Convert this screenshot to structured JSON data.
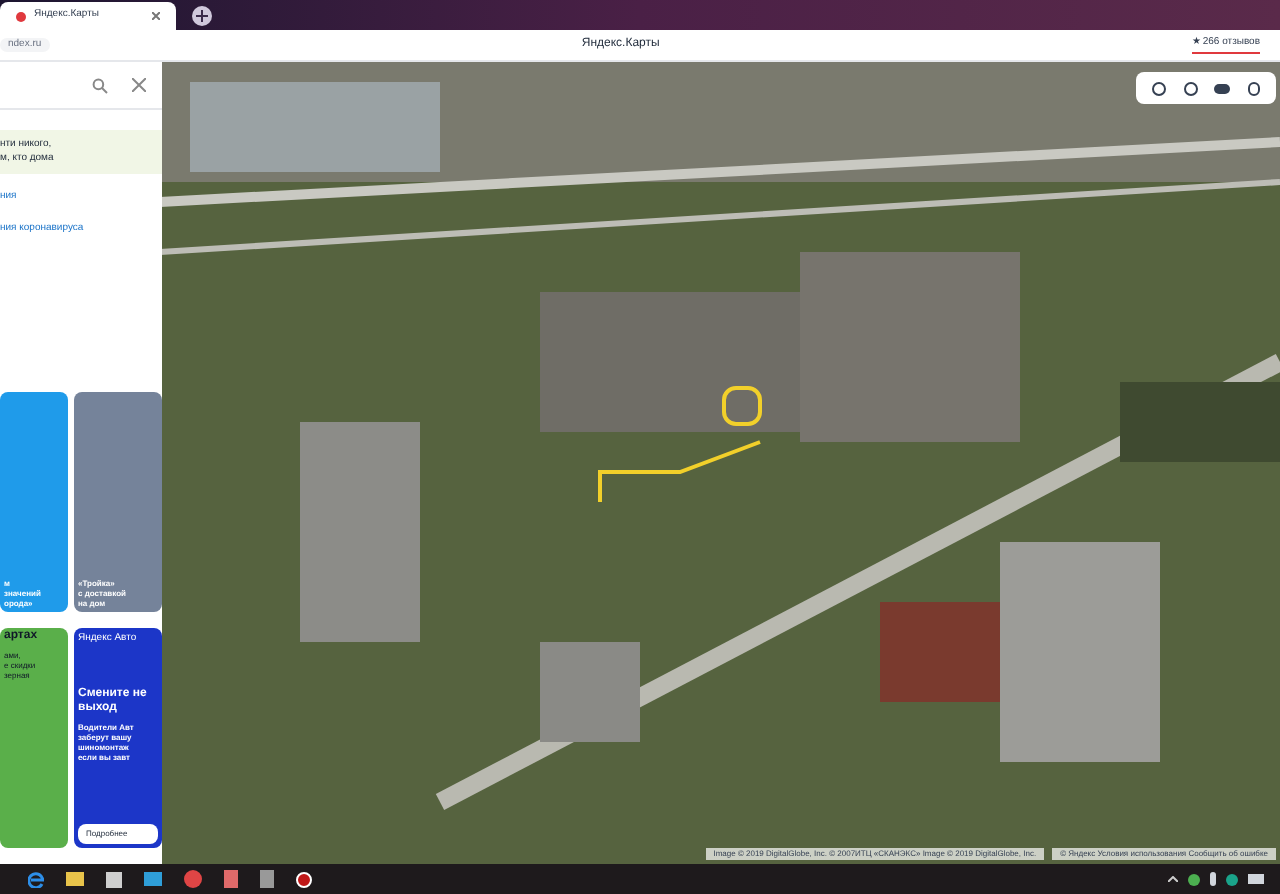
{
  "browser": {
    "tab": {
      "title": "Яндекс.Карты",
      "selected": true
    },
    "address": "ndex.ru",
    "page_title": "Яндекс.Карты",
    "reviews": "★ 266 отзывов"
  },
  "panel": {
    "notice": [
      "нти никого,",
      "м, кто дома"
    ],
    "links": [
      "ния",
      "ния коронавируса"
    ],
    "promo_cards": [
      {
        "kind": "blue",
        "lines": [
          "м",
          "значений",
          "орода»"
        ]
      },
      {
        "kind": "gray",
        "lines": [
          "«Тройка»",
          "с доставкой",
          "на дом"
        ]
      },
      {
        "kind": "green",
        "title": "артах",
        "lines": [
          "ами,",
          "е скидки",
          "зерная"
        ]
      },
      {
        "kind": "auto",
        "brand": "Яндекс Авто",
        "title": "Смените не выход",
        "lines": [
          "Водители Авт",
          "заберут вашу",
          "шиномонтаж",
          "если вы завт"
        ],
        "button": "Подробнее"
      }
    ]
  },
  "map": {
    "attribution": "Image © 2019 DigitalGlobe, Inc. © 2007ИТЦ «СКАНЭКС» Image © 2019 DigitalGlobe, Inc.",
    "footer": "© Яндекс  Условия использования  Сообщить об ошибке"
  }
}
